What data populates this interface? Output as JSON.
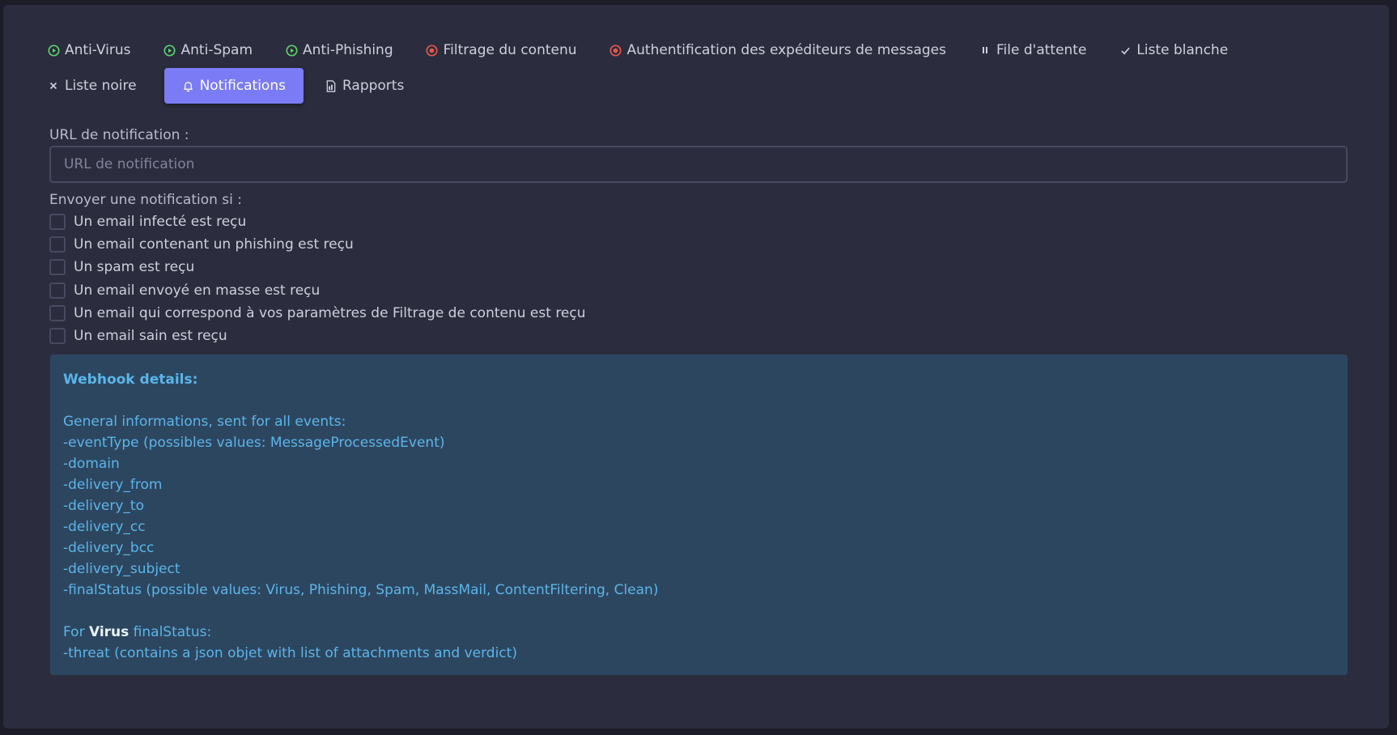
{
  "colors": {
    "background": "#1c1d28",
    "panel": "#2b2c3d",
    "active_tab": "#7b7cf5",
    "status_ok": "#5bd16a",
    "status_error": "#e5584b",
    "webhook_bg": "#2d4660",
    "webhook_text": "#5bb5e8"
  },
  "tabs": {
    "row1": [
      {
        "label": "Anti-Virus",
        "icon": "play-circle-icon",
        "status": "ok"
      },
      {
        "label": "Anti-Spam",
        "icon": "play-circle-icon",
        "status": "ok"
      },
      {
        "label": "Anti-Phishing",
        "icon": "play-circle-icon",
        "status": "ok"
      },
      {
        "label": "Filtrage du contenu",
        "icon": "stop-circle-icon",
        "status": "error"
      },
      {
        "label": "Authentification des expéditeurs de messages",
        "icon": "stop-circle-icon",
        "status": "error"
      },
      {
        "label": "File d'attente",
        "icon": "pause-icon",
        "status": "neutral"
      },
      {
        "label": "Liste blanche",
        "icon": "check-icon",
        "status": "neutral"
      }
    ],
    "row2": [
      {
        "label": "Liste noire",
        "icon": "close-icon",
        "status": "neutral"
      },
      {
        "label": "Notifications",
        "icon": "bell-icon",
        "status": "active"
      },
      {
        "label": "Rapports",
        "icon": "document-icon",
        "status": "neutral"
      }
    ]
  },
  "form": {
    "url_label": "URL de notification :",
    "url_placeholder": "URL de notification",
    "url_value": "",
    "send_label": "Envoyer une notification si :",
    "checkboxes": [
      {
        "label": "Un email infecté est reçu",
        "checked": false
      },
      {
        "label": "Un email contenant un phishing est reçu",
        "checked": false
      },
      {
        "label": "Un spam est reçu",
        "checked": false
      },
      {
        "label": "Un email envoyé en masse est reçu",
        "checked": false
      },
      {
        "label": "Un email qui correspond à vos paramètres de Filtrage de contenu est reçu",
        "checked": false
      },
      {
        "label": "Un email sain est reçu",
        "checked": false
      }
    ]
  },
  "webhook": {
    "title": "Webhook details:",
    "general_heading": "General informations, sent for all events:",
    "fields": [
      "-eventType (possibles values: MessageProcessedEvent)",
      "-domain",
      "-delivery_from",
      "-delivery_to",
      "-delivery_cc",
      "-delivery_bcc",
      "-delivery_subject",
      "-finalStatus (possible values: Virus, Phishing, Spam, MassMail, ContentFiltering, Clean)"
    ],
    "virus_prefix": "For ",
    "virus_bold": "Virus",
    "virus_suffix": " finalStatus:",
    "virus_fields": [
      "-threat (contains a json objet with list of attachments and verdict)"
    ]
  }
}
